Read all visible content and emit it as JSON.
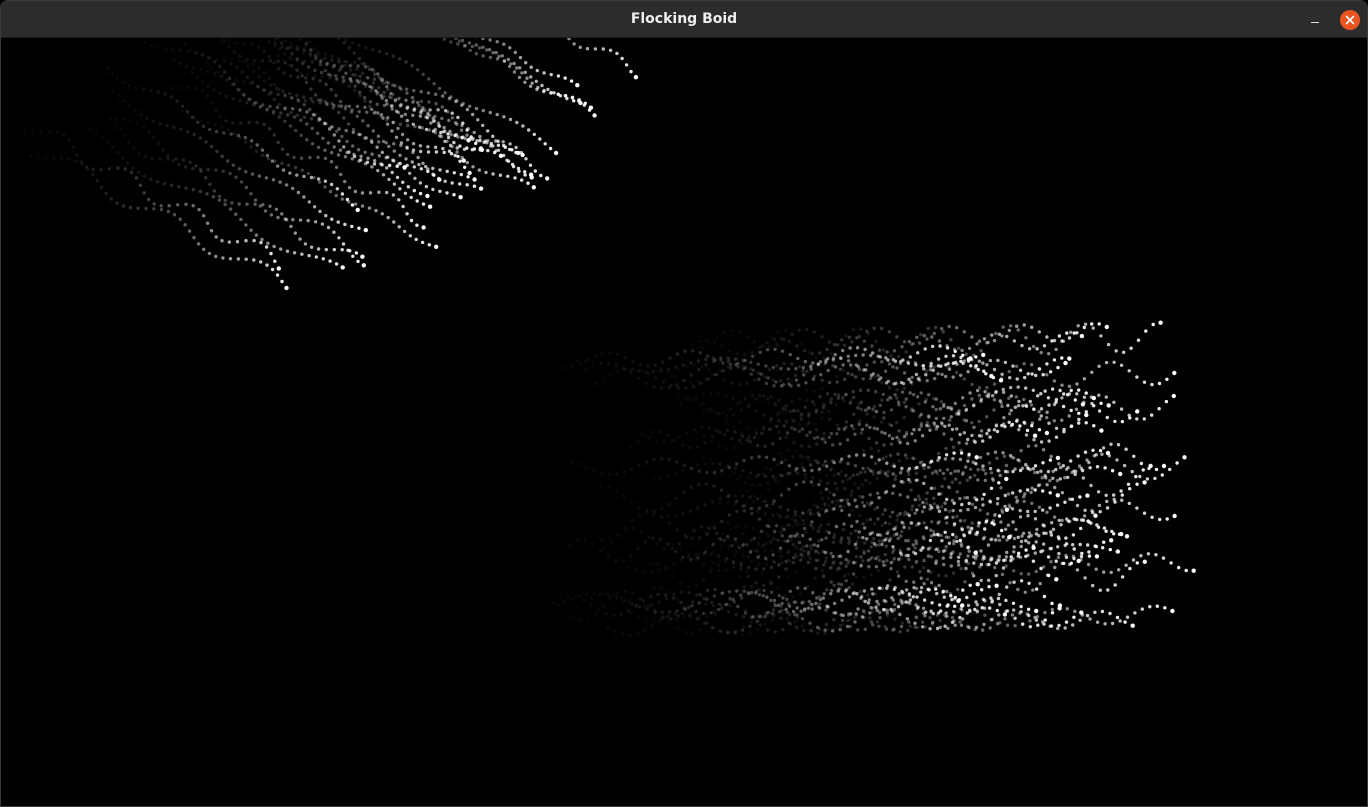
{
  "window": {
    "title": "Flocking Boid"
  },
  "controls": {
    "minimize_icon": "minimize-icon",
    "close_icon": "close-icon",
    "close_color": "#e95420"
  },
  "canvas": {
    "background": "#000000",
    "boid_color": "#ffffff"
  }
}
